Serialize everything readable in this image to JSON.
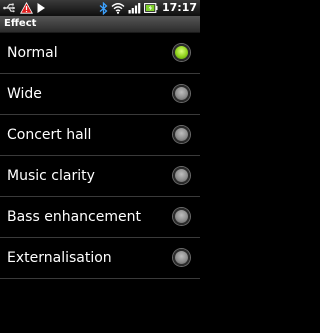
{
  "status_bar": {
    "time": "17:17",
    "left_icons": [
      "usb-icon",
      "warning-icon",
      "play-icon"
    ],
    "right_icons": [
      "bluetooth-icon",
      "wifi-icon",
      "signal-icon",
      "battery-icon"
    ]
  },
  "title": "Effect",
  "accent_color": "#8fd11c",
  "options": [
    {
      "label": "Normal",
      "selected": true
    },
    {
      "label": "Wide",
      "selected": false
    },
    {
      "label": "Concert hall",
      "selected": false
    },
    {
      "label": "Music clarity",
      "selected": false
    },
    {
      "label": "Bass enhancement",
      "selected": false
    },
    {
      "label": "Externalisation",
      "selected": false
    }
  ]
}
